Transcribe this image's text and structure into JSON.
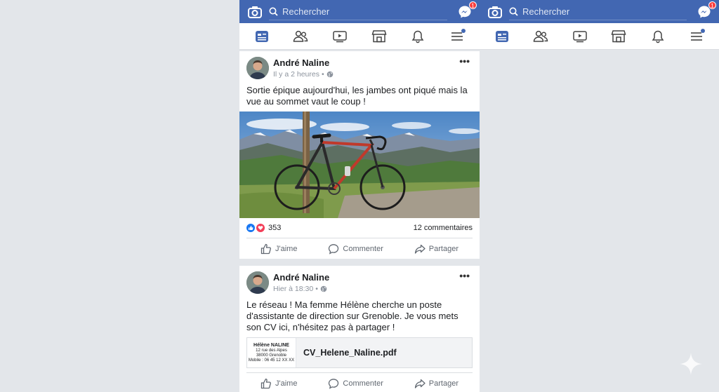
{
  "search": {
    "placeholder": "Rechercher"
  },
  "messenger": {
    "badge": "1"
  },
  "nav": {
    "items": [
      "news-feed",
      "friends",
      "watch",
      "marketplace",
      "notifications",
      "menu"
    ]
  },
  "posts": [
    {
      "author": "André Naline",
      "time": "Il y a 2 heures",
      "text": "Sortie épique aujourd'hui, les jambes ont piqué mais la vue au sommet vaut le coup !",
      "reactions_count": "353",
      "comments": "12 commentaires",
      "actions": {
        "like": "J'aime",
        "comment": "Commenter",
        "share": "Partager"
      }
    },
    {
      "author": "André Naline",
      "time": "Hier à 18:30",
      "text": "Le réseau ! Ma femme Hélène cherche un poste d'assistante de direction sur Grenoble. Je vous mets son CV ici, n'hésitez pas à partager !",
      "attachment": {
        "thumb_name": "Hélène NALINE",
        "thumb_line1": "12 rue des Alpes",
        "thumb_line2": "38000 Grenoble",
        "thumb_line3": "Mobile : 06 45 12 XX XX",
        "filename": "CV_Helene_Naline.pdf"
      },
      "actions": {
        "like": "J'aime",
        "comment": "Commenter",
        "share": "Partager"
      }
    }
  ],
  "colors": {
    "brand": "#4267b2",
    "badge": "#fa3e3e",
    "like": "#1877f2",
    "love": "#f33e58"
  }
}
